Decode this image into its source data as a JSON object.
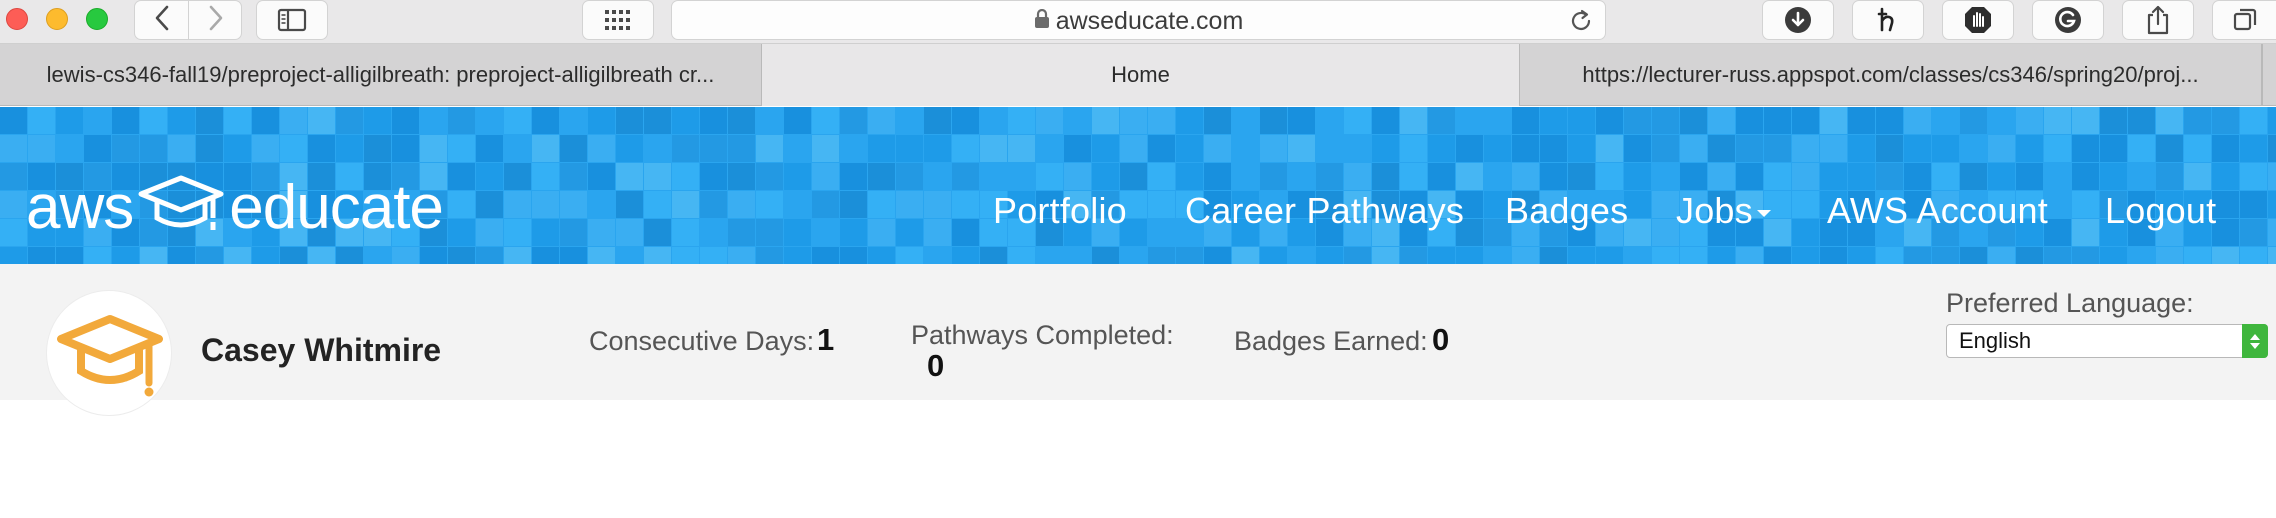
{
  "browser": {
    "address": "awseducate.com",
    "icons": {
      "back": "chevron-left-icon",
      "forward": "chevron-right-icon",
      "sidebar": "sidebar-icon",
      "grid": "grid-icon",
      "lock": "lock-icon",
      "reload": "reload-icon",
      "download": "download-icon",
      "honey": "honey-icon",
      "hand": "stop-hand-icon",
      "grammarly": "grammarly-icon",
      "share": "share-icon",
      "tabs": "tabs-icon"
    }
  },
  "tabs": [
    {
      "label": "lewis-cs346-fall19/preproject-alligilbreath: preproject-alligilbreath cr...",
      "active": false
    },
    {
      "label": "Home",
      "active": true
    },
    {
      "label": "https://lecturer-russ.appspot.com/classes/cs346/spring20/proj...",
      "active": false
    }
  ],
  "header": {
    "logo": {
      "left": "aws",
      "right": "educate"
    },
    "nav": {
      "portfolio": "Portfolio",
      "career": "Career Pathways",
      "badges": "Badges",
      "jobs": "Jobs",
      "account": "AWS Account",
      "logout": "Logout"
    },
    "colors": {
      "banner": "#2aa5ef",
      "accent": "#f2a93b"
    }
  },
  "profile": {
    "name": "Casey Whitmire",
    "consecutive_label": "Consecutive Days:",
    "consecutive_value": "1",
    "pathways_label": "Pathways Completed:",
    "pathways_value": "0",
    "badges_label": "Badges Earned:",
    "badges_value": "0",
    "language_label": "Preferred Language:",
    "language_value": "English"
  }
}
